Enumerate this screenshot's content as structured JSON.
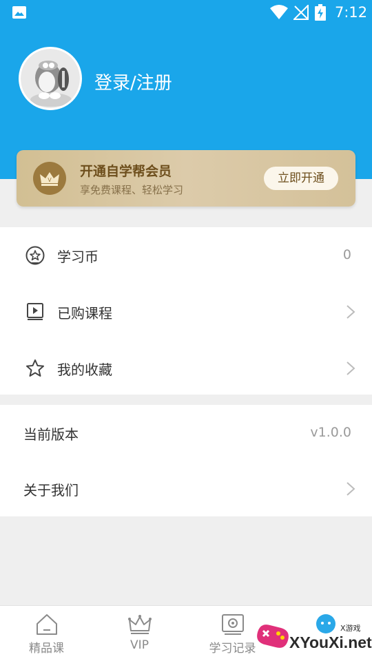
{
  "status_bar": {
    "time": "7:12"
  },
  "profile": {
    "login_text": "登录/注册"
  },
  "vip": {
    "title": "开通自学帮会员",
    "subtitle": "享免费课程、轻松学习",
    "button": "立即开通"
  },
  "menu": {
    "coins_label": "学习币",
    "coins_value": "0",
    "purchased_label": "已购课程",
    "favorites_label": "我的收藏",
    "version_label": "当前版本",
    "version_value": "v1.0.0",
    "about_label": "关于我们"
  },
  "tabs": [
    {
      "label": "精品课",
      "icon": "home-icon"
    },
    {
      "label": "VIP",
      "icon": "crown-icon"
    },
    {
      "label": "学习记录",
      "icon": "record-icon"
    },
    {
      "label": "",
      "icon": "profile-icon"
    }
  ],
  "watermark": {
    "text": "XYouXi.net",
    "small": "X游戏"
  },
  "colors": {
    "header": "#1aa6ea",
    "vip_gold": "#d2bf93",
    "vip_text": "#6e4f1d"
  }
}
